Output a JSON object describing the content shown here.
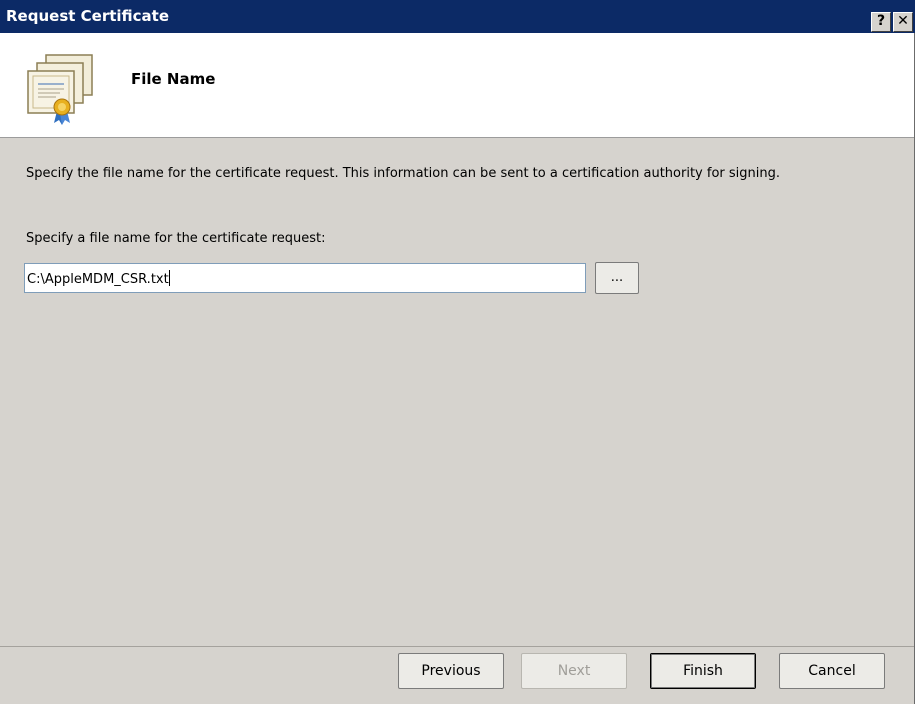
{
  "window": {
    "title": "Request Certificate",
    "help_label": "?",
    "close_label": "✕"
  },
  "header": {
    "title": "File Name",
    "icon": "certificate-icon"
  },
  "main": {
    "description": "Specify the file name for the certificate request. This information can be sent to a certification authority for signing.",
    "file_label": "Specify a file name for the certificate request:",
    "file_value": "C:\\AppleMDM_CSR.txt",
    "browse_label": "..."
  },
  "footer": {
    "previous_label": "Previous",
    "next_label": "Next",
    "finish_label": "Finish",
    "cancel_label": "Cancel"
  }
}
